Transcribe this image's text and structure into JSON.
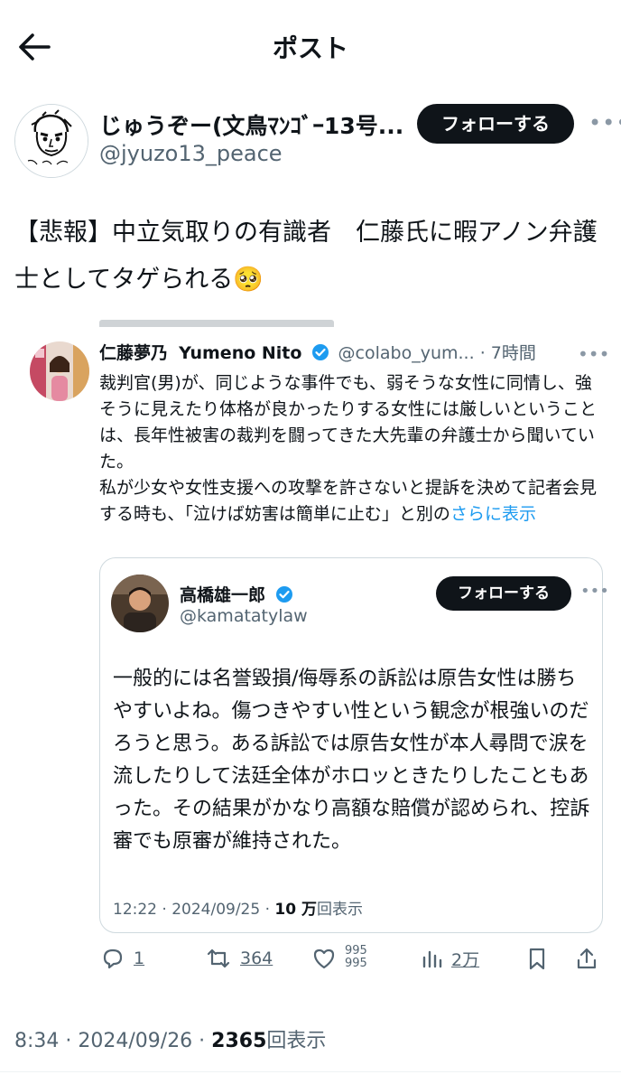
{
  "header": {
    "title": "ポスト"
  },
  "author": {
    "name": "じゅうぞー(文鳥ﾏﾝｺﾞｰ13号...",
    "handle": "@jyuzo13_peace",
    "follow_label": "フォローする"
  },
  "post": {
    "text": "【悲報】中立気取りの有識者　仁藤氏に暇アノン弁護士としてタゲられる🥺"
  },
  "retweet": {
    "name": "仁藤夢乃",
    "name_en": "Yumeno Nito",
    "handle": "@colabo_yum...",
    "time": "· 7時間",
    "text": "裁判官(男)が、同じような事件でも、弱そうな女性に同情し、強そうに見えたり体格が良かったりする女性には厳しいということは、長年性被害の裁判を闘ってきた大先輩の弁護士から聞いていた。\n私が少女や女性支援への攻撃を許さないと提訴を決めて記者会見する時も、「泣けば妨害は簡単に止む」と別の",
    "more_label": "さらに表示"
  },
  "quote": {
    "name": "高橋雄一郎",
    "handle": "@kamatatylaw",
    "follow_label": "フォローする",
    "text": "一般的には名誉毀損/侮辱系の訴訟は原告女性は勝ちやすいよね。傷つきやすい性という観念が根強いのだろうと思う。ある訴訟では原告女性が本人尋問で涙を流したりして法廷全体がホロッときたりしたこともあった。その結果がかなり高額な賠償が認められ、控訴審でも原審が維持された。",
    "time_date": "12:22 · 2024/09/25 · ",
    "views": "10 万",
    "views_label": "回表示"
  },
  "actions": {
    "reply_count": "1",
    "repost_count": "364",
    "like_count_top": "995",
    "like_count_bottom": "995",
    "views_count": "2万"
  },
  "footer": {
    "time_date": "8:34 · 2024/09/26 · ",
    "views": "2365",
    "views_label": "回表示"
  },
  "icons": {
    "back": "back-arrow-icon",
    "verified": "verified-badge-icon",
    "reply": "reply-icon",
    "repost": "repost-icon",
    "like": "heart-icon",
    "views": "views-chart-icon",
    "bookmark": "bookmark-icon",
    "share": "share-icon"
  },
  "colors": {
    "verified": "#1d9bf0",
    "link": "#1d9bf0",
    "muted": "#536471",
    "text": "#0f1419"
  }
}
